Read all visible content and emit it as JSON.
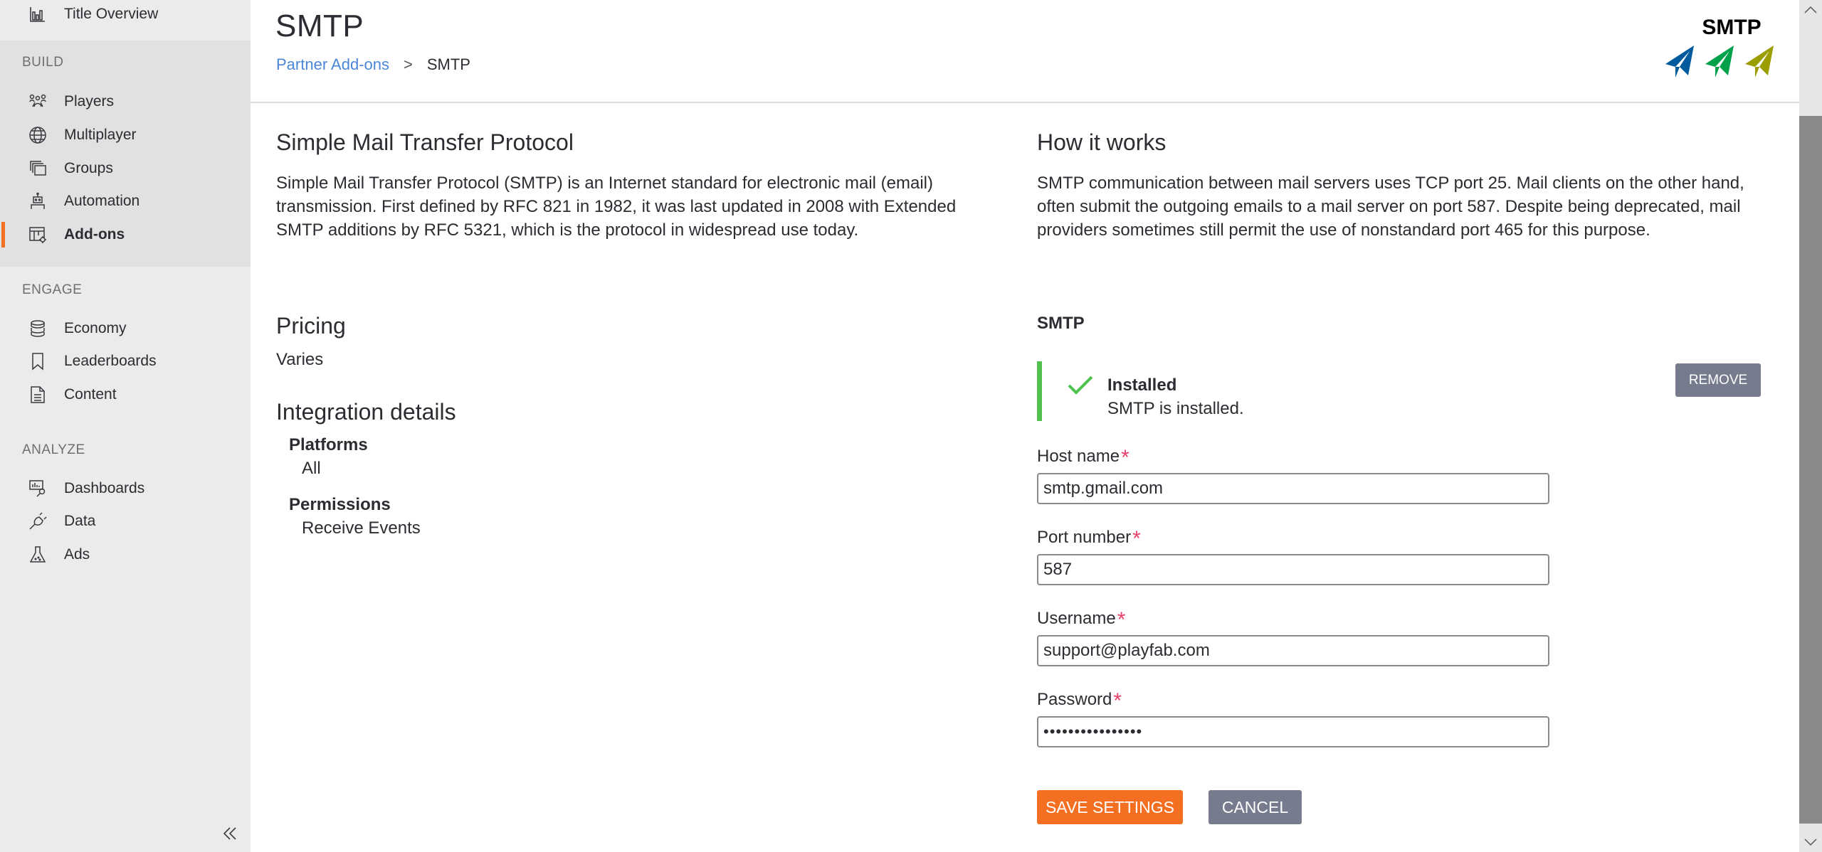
{
  "sidebar": {
    "top_item": {
      "label": "Title Overview",
      "icon": "bar-chart-icon"
    },
    "sections": [
      {
        "label": "BUILD",
        "items": [
          {
            "label": "Players",
            "icon": "people-icon",
            "active": false
          },
          {
            "label": "Multiplayer",
            "icon": "globe-icon",
            "active": false
          },
          {
            "label": "Groups",
            "icon": "stacked-windows-icon",
            "active": false
          },
          {
            "label": "Automation",
            "icon": "robot-icon",
            "active": false
          },
          {
            "label": "Add-ons",
            "icon": "addon-gear-icon",
            "active": true
          }
        ]
      },
      {
        "label": "ENGAGE",
        "items": [
          {
            "label": "Economy",
            "icon": "coins-stack-icon",
            "active": false
          },
          {
            "label": "Leaderboards",
            "icon": "bookmark-icon",
            "active": false
          },
          {
            "label": "Content",
            "icon": "document-icon",
            "active": false
          }
        ]
      },
      {
        "label": "ANALYZE",
        "items": [
          {
            "label": "Dashboards",
            "icon": "dashboard-search-icon",
            "active": false
          },
          {
            "label": "Data",
            "icon": "plug-icon",
            "active": false
          },
          {
            "label": "Ads",
            "icon": "flask-icon",
            "active": false
          }
        ]
      }
    ],
    "collapse_icon": "double-chevron-left-icon"
  },
  "header": {
    "title": "SMTP",
    "breadcrumb": {
      "parent": "Partner Add-ons",
      "separator": ">",
      "current": "SMTP"
    },
    "logo": {
      "text": "SMTP",
      "colors": [
        "#005a9e",
        "#00a14b",
        "#9c9e00"
      ]
    }
  },
  "about": {
    "heading": "Simple Mail Transfer Protocol",
    "body": "Simple Mail Transfer Protocol (SMTP) is an Internet standard for electronic mail (email) transmission. First defined by RFC 821 in 1982, it was last updated in 2008 with Extended SMTP additions by RFC 5321, which is the protocol in widespread use today."
  },
  "how_it_works": {
    "heading": "How it works",
    "body": "SMTP communication between mail servers uses TCP port 25. Mail clients on the other hand, often submit the outgoing emails to a mail server on port 587. Despite being deprecated, mail providers sometimes still permit the use of nonstandard port 465 for this purpose."
  },
  "pricing": {
    "heading": "Pricing",
    "value": "Varies"
  },
  "integration": {
    "heading": "Integration details",
    "platforms_label": "Platforms",
    "platforms_value": "All",
    "permissions_label": "Permissions",
    "permissions_value": "Receive Events"
  },
  "settings": {
    "heading": "SMTP",
    "status": {
      "title": "Installed",
      "message": "SMTP is installed.",
      "color": "#4fc14c"
    },
    "remove_label": "REMOVE",
    "fields": {
      "host": {
        "label": "Host name",
        "value": "smtp.gmail.com",
        "required": "*"
      },
      "port": {
        "label": "Port number",
        "value": "587",
        "required": "*"
      },
      "username": {
        "label": "Username",
        "value": "support@playfab.com",
        "required": "*"
      },
      "password": {
        "label": "Password",
        "value": "••••••••••••••••",
        "required": "*"
      }
    },
    "save_label": "SAVE SETTINGS",
    "cancel_label": "CANCEL"
  },
  "colors": {
    "accent": "#f46f21",
    "secondary_button": "#767b8e",
    "link": "#4b87d6",
    "required": "#e8416b"
  }
}
